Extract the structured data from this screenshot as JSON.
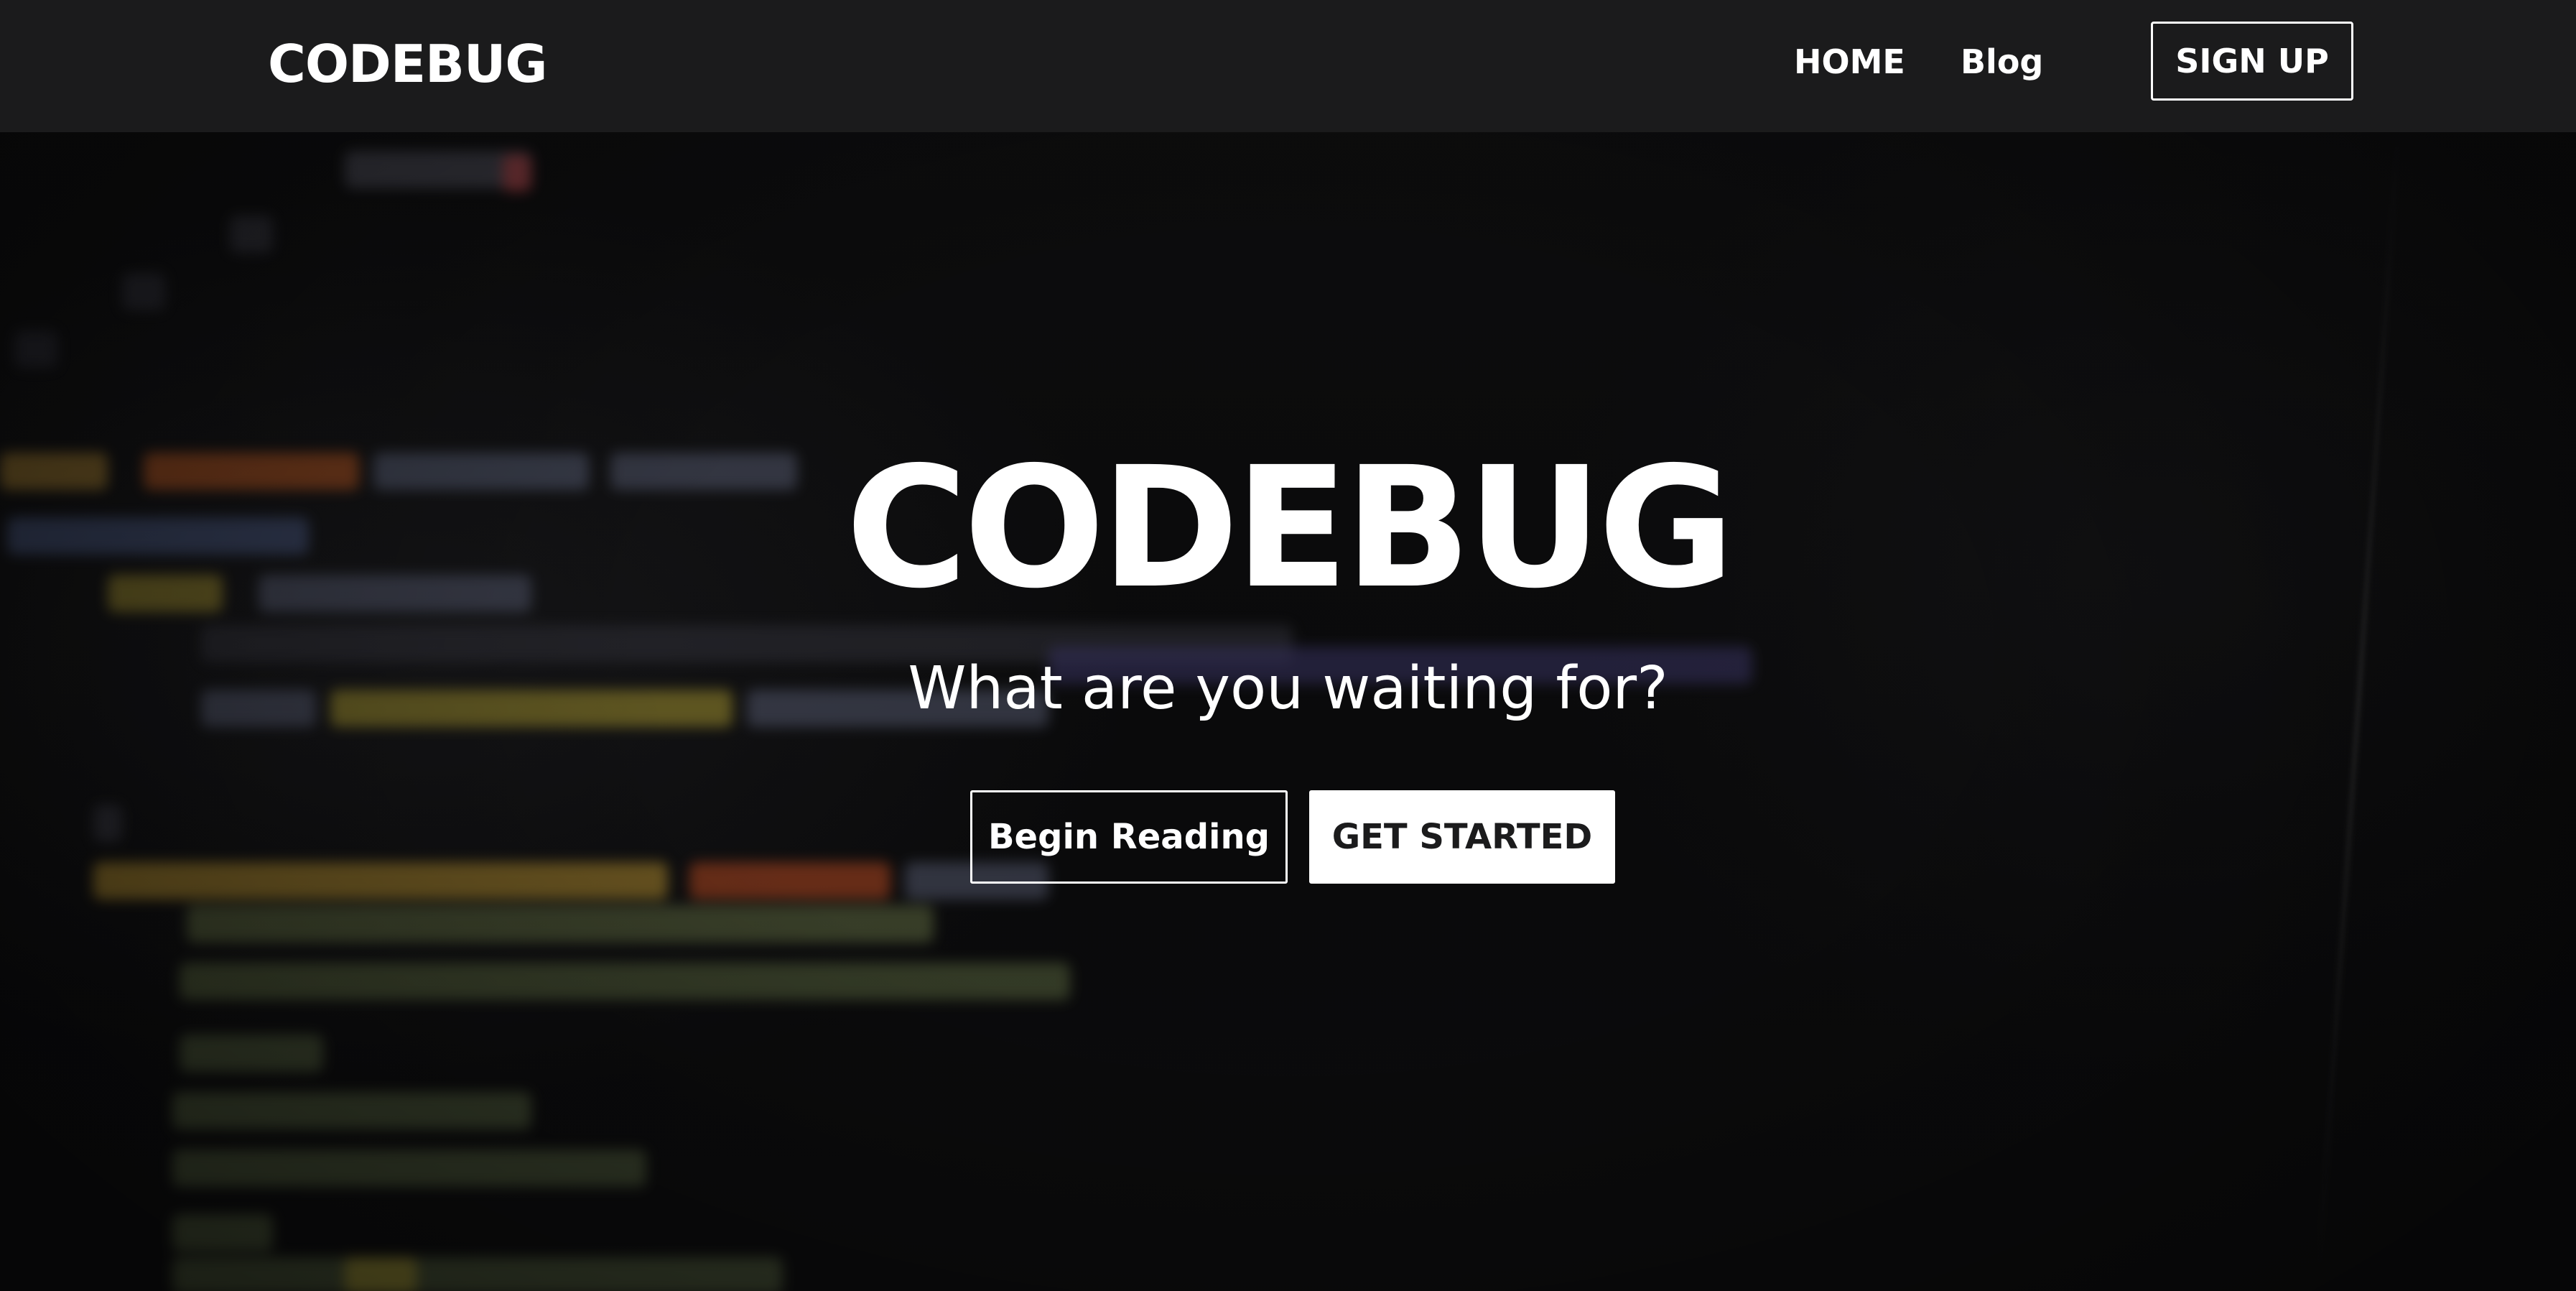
{
  "navbar": {
    "brand": "CODEBUG",
    "links": [
      {
        "label": "HOME"
      },
      {
        "label": "Blog"
      }
    ],
    "signup_label": "SIGN UP"
  },
  "hero": {
    "title": "CODEBUG",
    "subtitle": "What are you waiting for?",
    "primary_button": "Begin Reading",
    "secondary_button": "GET STARTED"
  },
  "colors": {
    "navbar_bg": "#1b1b1c",
    "page_bg": "#0a0a0b",
    "text": "#ffffff",
    "solid_button_text": "#1b1b1c"
  }
}
